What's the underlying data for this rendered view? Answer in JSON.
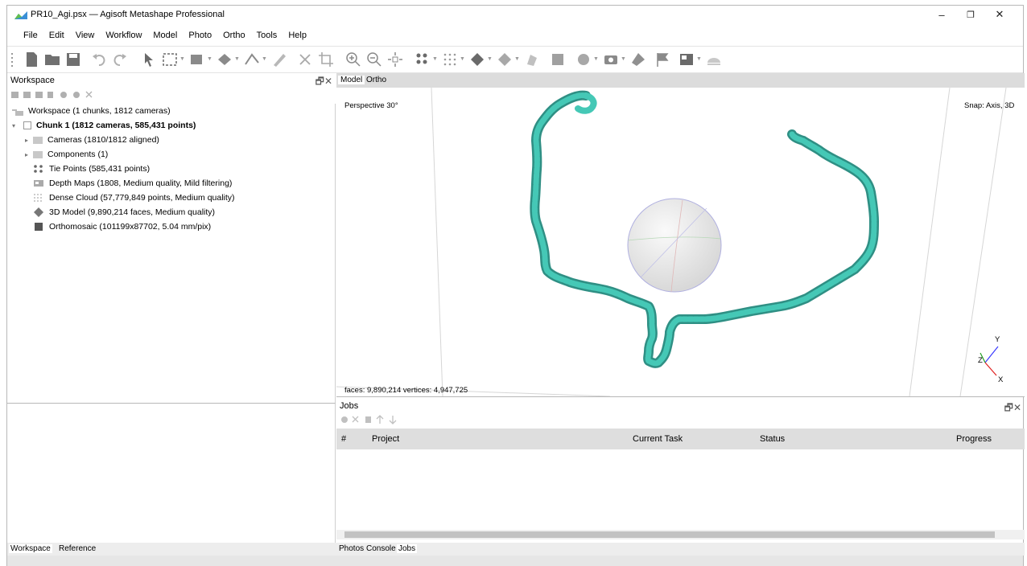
{
  "window": {
    "title": "PR10_Agi.psx — Agisoft Metashape Professional",
    "minimize": "–",
    "maximize": "❐",
    "close": "✕"
  },
  "menu": [
    "File",
    "Edit",
    "View",
    "Workflow",
    "Model",
    "Photo",
    "Ortho",
    "Tools",
    "Help"
  ],
  "workspace_panel": {
    "title": "Workspace",
    "root": "Workspace (1 chunks, 1812 cameras)",
    "chunk": "Chunk 1 (1812 cameras, 585,431 points)",
    "items": [
      {
        "label": "Cameras (1810/1812 aligned)",
        "icon": "folder-icon"
      },
      {
        "label": "Components (1)",
        "icon": "folder-icon"
      },
      {
        "label": "Tie Points (585,431 points)",
        "icon": "tie-points-icon"
      },
      {
        "label": "Depth Maps (1808, Medium quality, Mild filtering)",
        "icon": "depth-maps-icon"
      },
      {
        "label": "Dense Cloud (57,779,849 points, Medium quality)",
        "icon": "dense-cloud-icon"
      },
      {
        "label": "3D Model (9,890,214 faces, Medium quality)",
        "icon": "model-icon"
      },
      {
        "label": "Orthomosaic (101199x87702, 5.04 mm/pix)",
        "icon": "orthomosaic-icon"
      }
    ]
  },
  "bottom_tabs_left": [
    "Workspace",
    "Reference"
  ],
  "bottom_tabs_right": [
    "Photos",
    "Console",
    "Jobs"
  ],
  "view_tabs": [
    "Model",
    "Ortho"
  ],
  "viewport": {
    "projection": "Perspective 30°",
    "snap": "Snap: Axis, 3D",
    "stats": "faces: 9,890,214 vertices: 4,947,725",
    "axis_y": "Y",
    "axis_z": "Z",
    "axis_x": "X"
  },
  "jobs": {
    "title": "Jobs",
    "columns": [
      "#",
      "Project",
      "Current Task",
      "Status",
      "Progress"
    ]
  },
  "colors": {
    "model_teal": "#3fbfae",
    "active_tab": "#ffffff",
    "column_header_bg": "#dedede"
  }
}
